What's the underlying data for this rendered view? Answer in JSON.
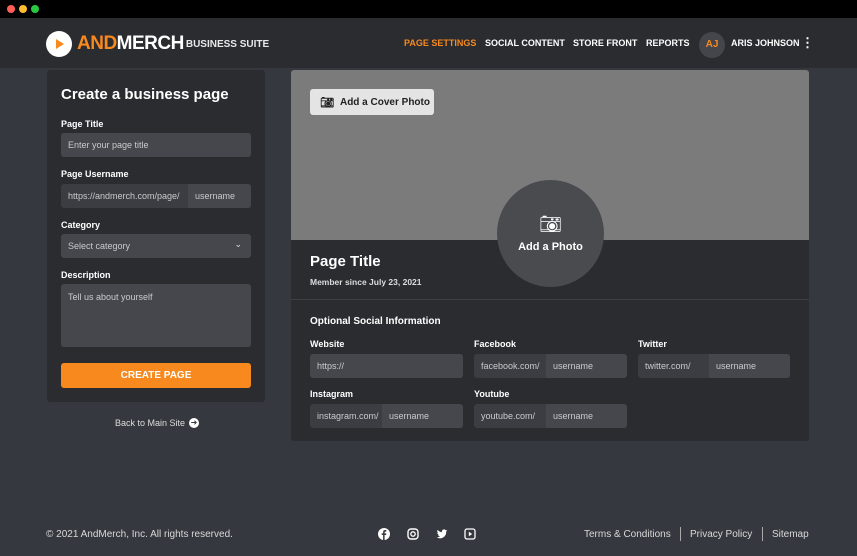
{
  "window": {
    "controls": [
      "#ff5f57",
      "#febc2e",
      "#28c840"
    ]
  },
  "header": {
    "logo_text_a": "AND",
    "logo_text_b": "MERCH",
    "suite": "BUSINESS SUITE",
    "nav": [
      {
        "label": "PAGE SETTINGS",
        "active": true
      },
      {
        "label": "SOCIAL CONTENT"
      },
      {
        "label": "STORE FRONT"
      },
      {
        "label": "REPORTS"
      }
    ],
    "user": {
      "initials": "AJ",
      "name": "ARIS JOHNSON"
    }
  },
  "colors": {
    "accent": "#f7891e"
  },
  "form": {
    "title": "Create a business page",
    "page_title_label": "Page Title",
    "page_title_placeholder": "Enter your page title",
    "username_label": "Page Username",
    "username_prefix": "https://andmerch.com/page/",
    "username_placeholder": "username",
    "category_label": "Category",
    "category_value": "Select category",
    "description_label": "Description",
    "description_placeholder": "Tell us about yourself",
    "submit": "CREATE PAGE",
    "back": "Back to Main Site"
  },
  "preview": {
    "cover_button": "Add a Cover Photo",
    "photo_button": "Add a Photo",
    "page_title": "Page Title",
    "member_since": "Member since July 23, 2021",
    "social_title": "Optional Social Information",
    "website_label": "Website",
    "website_placeholder": "https://",
    "facebook_label": "Facebook",
    "facebook_prefix": "facebook.com/",
    "twitter_label": "Twitter",
    "twitter_prefix": "twitter.com/",
    "instagram_label": "Instagram",
    "instagram_prefix": "instagram.com/",
    "youtube_label": "Youtube",
    "youtube_prefix": "youtube.com/",
    "username_placeholder": "username"
  },
  "footer": {
    "copyright": "© 2021 AndMerch, Inc. All rights reserved.",
    "links": [
      "Terms & Conditions",
      "Privacy Policy",
      "Sitemap"
    ],
    "social_icons": [
      "facebook-icon",
      "instagram-icon",
      "twitter-icon",
      "youtube-icon"
    ]
  }
}
